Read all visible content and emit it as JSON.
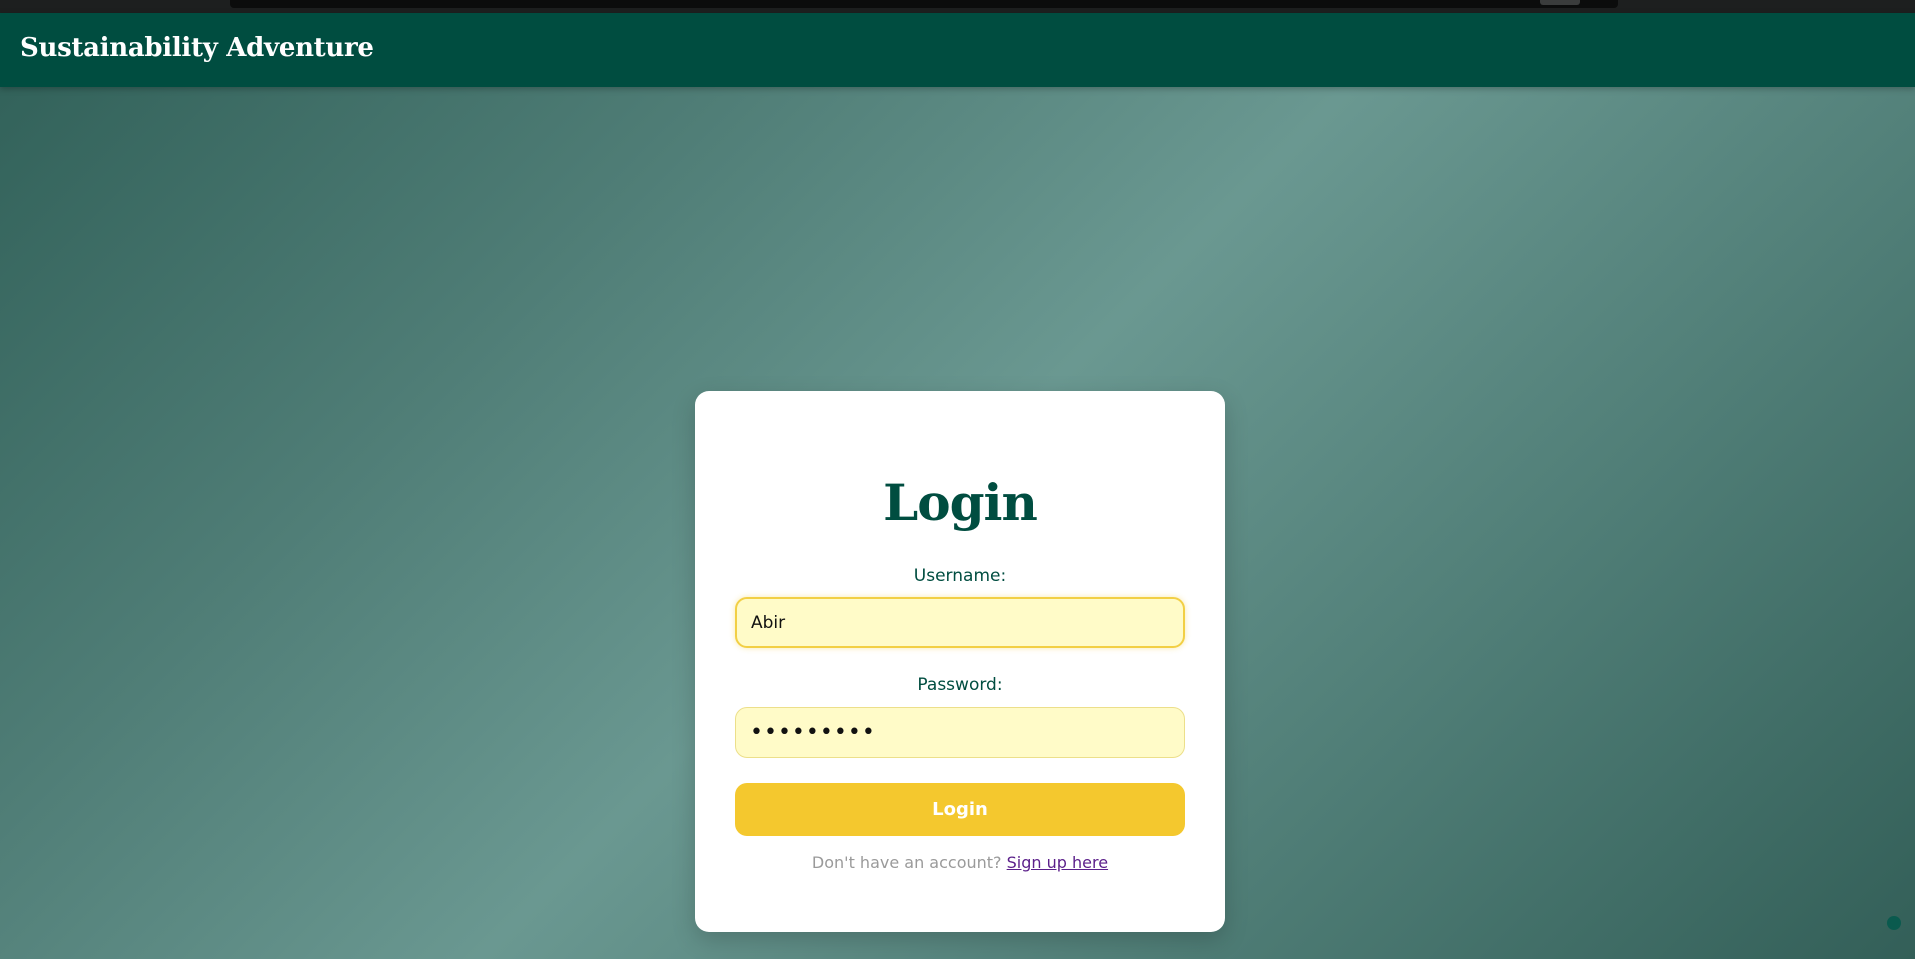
{
  "app": {
    "brand_title": "Sustainability Adventure"
  },
  "login_form": {
    "title": "Login",
    "username_label": "Username:",
    "username_value": "Abir",
    "password_label": "Password:",
    "password_value": "•••••••••",
    "submit_label": "Login",
    "signup_prompt": "Don't have an account?",
    "signup_link": "Sign up here"
  },
  "colors": {
    "navbar": "#004d40",
    "accent_yellow": "#f4c82e",
    "input_background": "#fffbc8",
    "link": "#5b1f8a"
  }
}
